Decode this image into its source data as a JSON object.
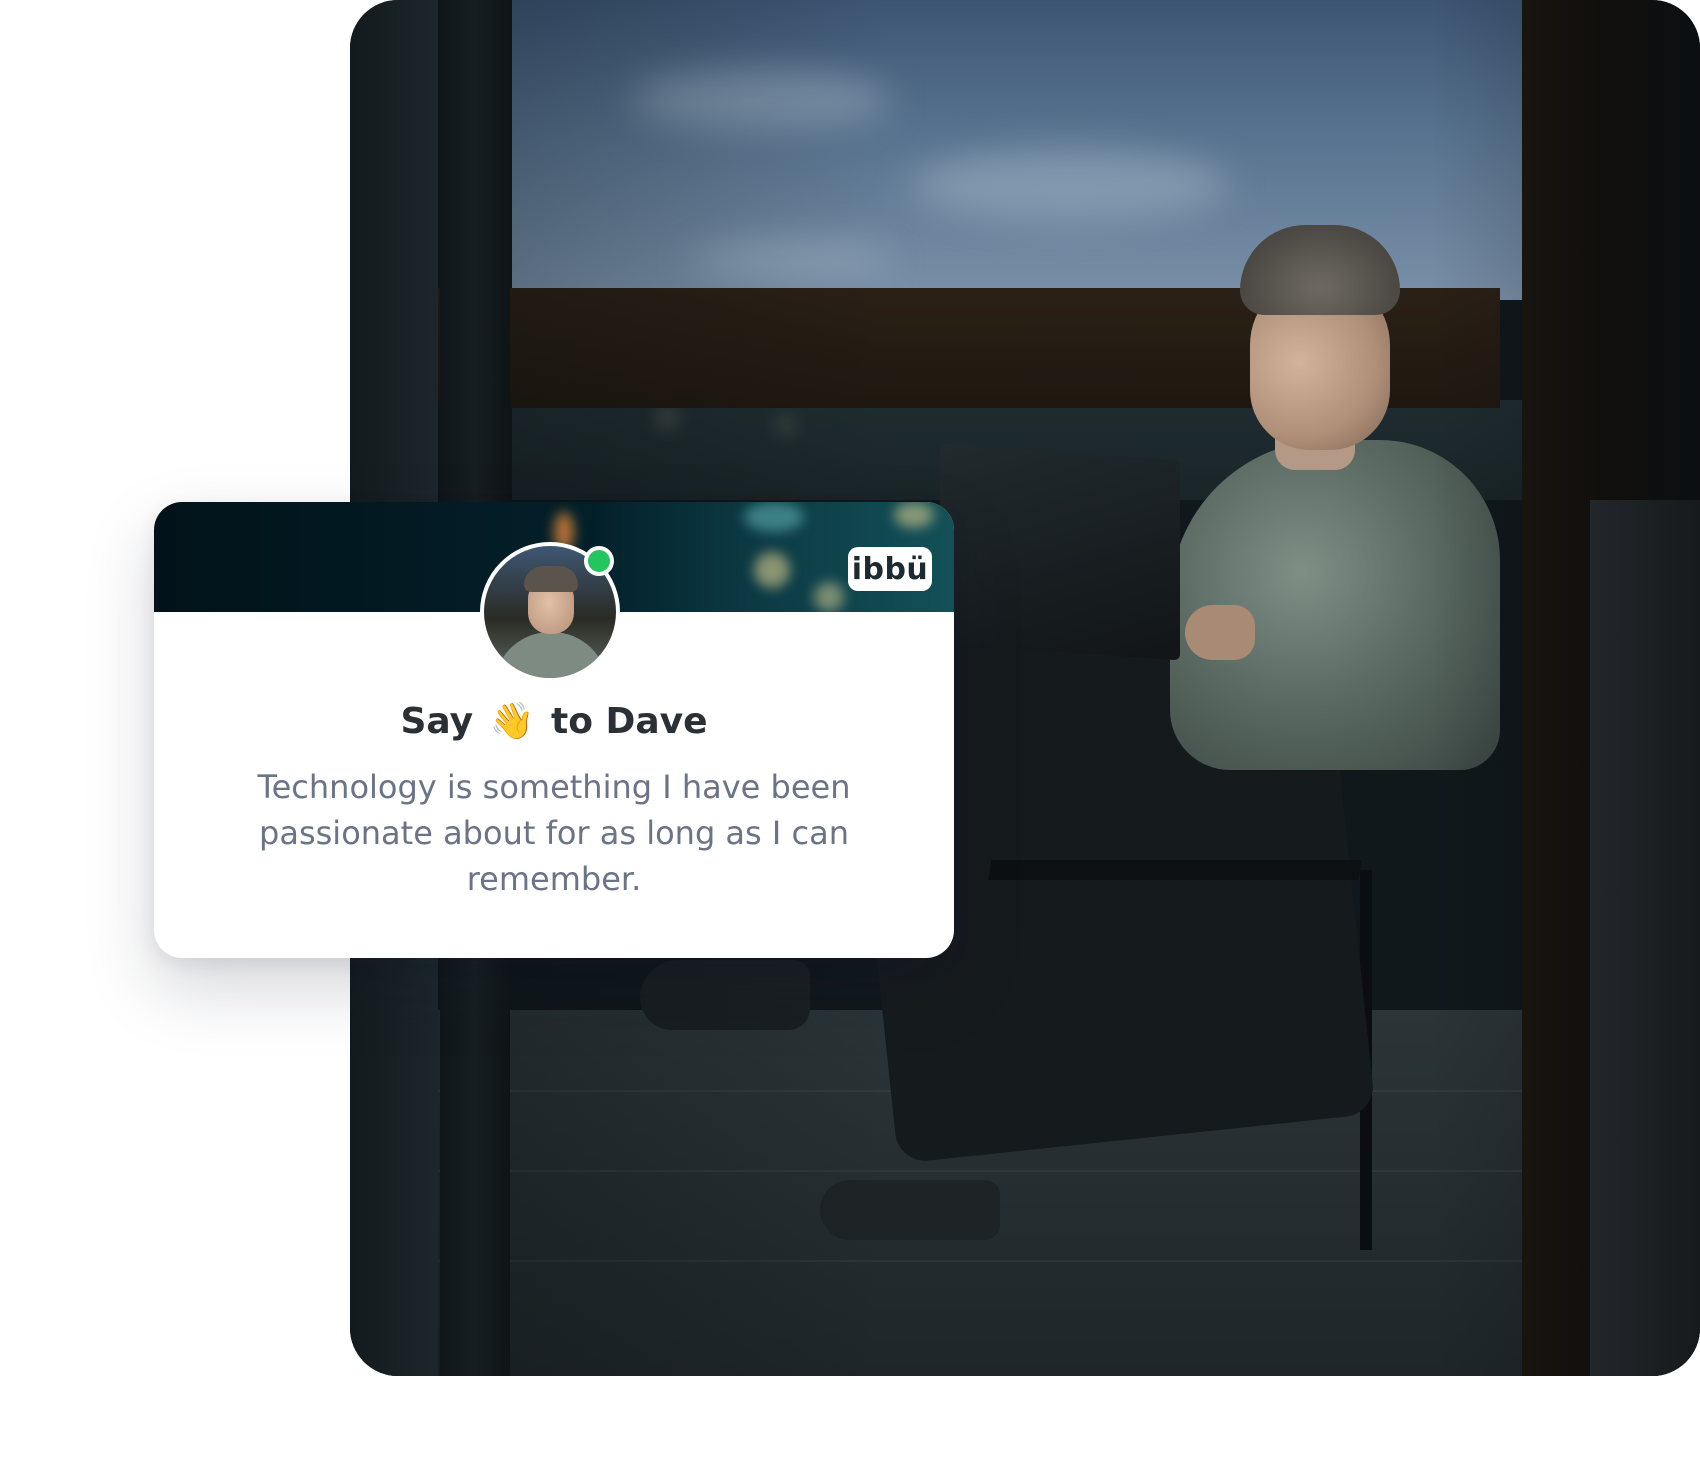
{
  "profile_card": {
    "brand_logo_text": "ibbü",
    "status": "online",
    "status_color": "#22c55e",
    "greeting_prefix": "Say",
    "greeting_emoji": "👋",
    "greeting_suffix": "to Dave",
    "bio": "Technology is something I have been passionate about for as long as I can remember."
  },
  "background_photo": {
    "icon": "photo-man-with-laptop-on-balcony"
  }
}
